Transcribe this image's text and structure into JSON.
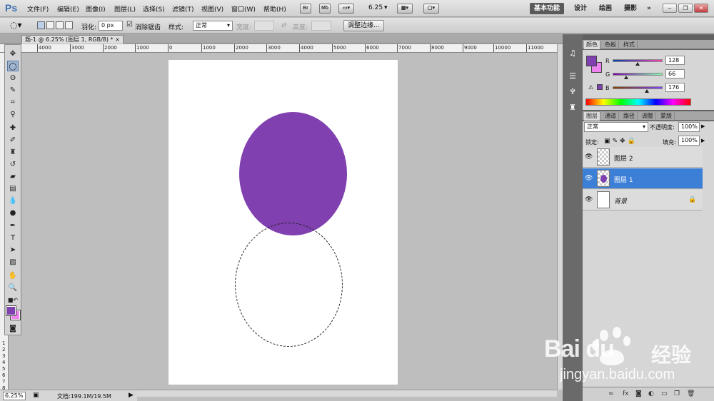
{
  "app": {
    "logo": "Ps"
  },
  "menu": [
    "文件(F)",
    "编辑(E)",
    "图像(I)",
    "图层(L)",
    "选择(S)",
    "滤镜(T)",
    "视图(V)",
    "窗口(W)",
    "帮助(H)"
  ],
  "menubar": {
    "br_label": "Br",
    "mb_label": "Mb",
    "zoom": "6.25",
    "workspaces": [
      "基本功能",
      "设计",
      "绘画",
      "摄影"
    ],
    "more": "»"
  },
  "options": {
    "feather_label": "羽化:",
    "feather_value": "0 px",
    "antialias_label": "消除锯齿",
    "style_label": "样式:",
    "style_value": "正常",
    "width_label": "宽度:",
    "height_label": "高度:",
    "refine_edge": "调整边缘..."
  },
  "document": {
    "tab_title": "题-1 @ 6.25% (图层 1, RGB/8) * ×",
    "ruler_h": [
      "4000",
      "3000",
      "2000",
      "1000",
      "0",
      "1000",
      "2000",
      "3000",
      "4000",
      "5000",
      "6000",
      "7000",
      "8000",
      "9000",
      "10000",
      "11000"
    ],
    "ruler_v": [
      "1",
      "2",
      "3",
      "4",
      "5",
      "6",
      "7",
      "8"
    ],
    "zoom_value": "6.25%",
    "doc_size": "文档:199.1M/19.5M",
    "fill_color": "#8040b0"
  },
  "colors": {
    "foreground": "#8040b0",
    "background": "#ee82ee",
    "channels": [
      {
        "label": "R",
        "value": "128",
        "fraction": 0.502
      },
      {
        "label": "G",
        "value": "66",
        "fraction": 0.259
      },
      {
        "label": "B",
        "value": "176",
        "fraction": 0.69
      }
    ]
  },
  "color_panel_tabs": [
    "颜色",
    "色板",
    "样式"
  ],
  "layer_panel_tabs": [
    "图层",
    "通道",
    "路径",
    "调整",
    "蒙版"
  ],
  "layers": {
    "blend_mode": "正常",
    "opacity_label": "不透明度:",
    "opacity_value": "100%",
    "lock_label": "锁定:",
    "fill_label": "填充:",
    "fill_value": "100%",
    "items": [
      {
        "name": "图层 2",
        "selected": false
      },
      {
        "name": "图层 1",
        "selected": true
      },
      {
        "name": "背景",
        "selected": false
      }
    ]
  },
  "watermark": {
    "brand": "Bai du",
    "cn": "经验",
    "url": "jingyan.baidu.com"
  }
}
